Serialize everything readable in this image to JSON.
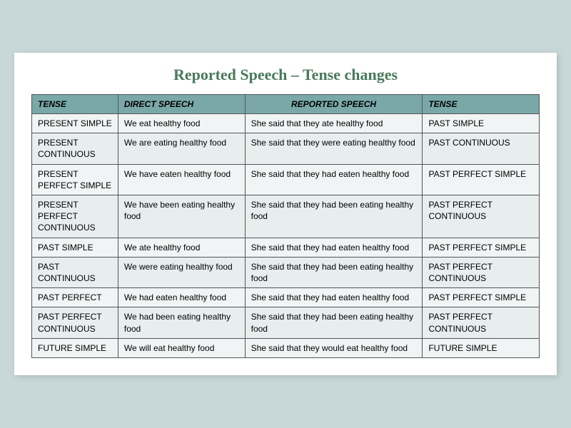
{
  "title": "Reported Speech – Tense changes",
  "headers": {
    "tense1": "TENSE",
    "direct": "DIRECT SPEECH",
    "reported": "REPORTED SPEECH",
    "tense2": "TENSE"
  },
  "rows": [
    {
      "tense1": "PRESENT SIMPLE",
      "direct": "We eat healthy food",
      "reported": "She said that they ate healthy food",
      "tense2": "PAST SIMPLE"
    },
    {
      "tense1": "PRESENT CONTINUOUS",
      "direct": "We are eating healthy food",
      "reported": "She said that they were eating healthy food",
      "tense2": "PAST CONTINUOUS"
    },
    {
      "tense1": "PRESENT PERFECT SIMPLE",
      "direct": "We have eaten healthy food",
      "reported": "She said that they had eaten healthy food",
      "tense2": "PAST PERFECT SIMPLE"
    },
    {
      "tense1": "PRESENT PERFECT CONTINUOUS",
      "direct": "We have been eating healthy food",
      "reported": "She said that they had been eating  healthy food",
      "tense2": "PAST PERFECT CONTINUOUS"
    },
    {
      "tense1": "PAST SIMPLE",
      "direct": "We ate healthy food",
      "reported": "She said that they had eaten healthy food",
      "tense2": "PAST PERFECT SIMPLE"
    },
    {
      "tense1": "PAST CONTINUOUS",
      "direct": "We were eating healthy food",
      "reported": "She said that they had been eating healthy food",
      "tense2": "PAST PERFECT CONTINUOUS"
    },
    {
      "tense1": "PAST PERFECT",
      "direct": "We had eaten healthy food",
      "reported": "She said that they had eaten healthy food",
      "tense2": "PAST PERFECT SIMPLE"
    },
    {
      "tense1": "PAST PERFECT CONTINUOUS",
      "direct": "We had been eating healthy food",
      "reported": "She said that they had been eating  healthy food",
      "tense2": "PAST PERFECT CONTINUOUS"
    },
    {
      "tense1": "FUTURE SIMPLE",
      "direct": "We will eat healthy food",
      "reported": "She said that they would eat healthy food",
      "tense2": "FUTURE SIMPLE"
    }
  ]
}
